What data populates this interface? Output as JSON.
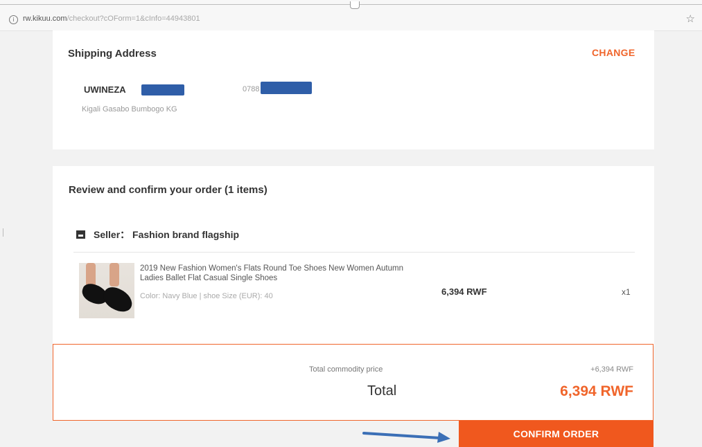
{
  "browser": {
    "url_host": "rw.kikuu.com",
    "url_path": "/checkout?cOForm=1&cInfo=44943801",
    "icons": {
      "info": "info-icon",
      "bookmark": "star-icon"
    }
  },
  "shipping": {
    "title": "Shipping Address",
    "change_label": "CHANGE",
    "name": "UWINEZA",
    "phone": "0788",
    "address": "Kigali Gasabo Bumbogo KG"
  },
  "order": {
    "title": "Review and confirm your order (1 items)",
    "seller_label": "Seller： Fashion brand flagship",
    "items": [
      {
        "name": "2019 New Fashion Women's Flats Round Toe Shoes New Women Autumn Ladies Ballet Flat Casual Single Shoes",
        "variant": "Color: Navy Blue | shoe Size (EUR): 40",
        "price": "6,394 RWF",
        "qty": "x1"
      }
    ]
  },
  "summary": {
    "commodity_label": "Total commodity price",
    "commodity_value": "+6,394 RWF",
    "total_label": "Total",
    "total_value": "6,394 RWF"
  },
  "actions": {
    "confirm_label": "CONFIRM ORDER"
  },
  "colors": {
    "accent": "#f0652b",
    "annotation_arrow": "#3b6fb6",
    "redaction": "#2f5ea8"
  }
}
